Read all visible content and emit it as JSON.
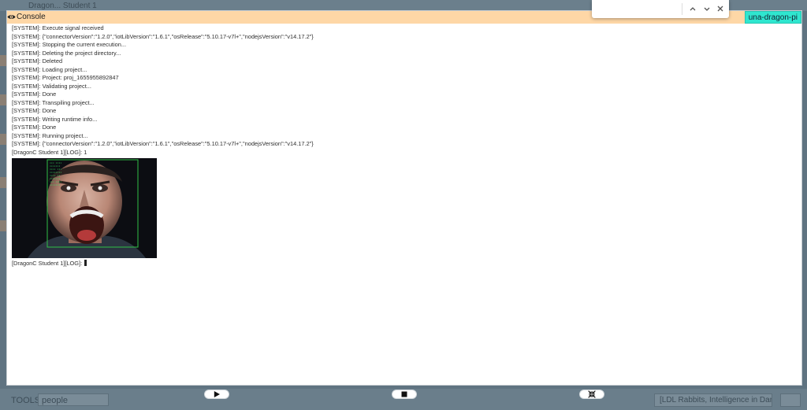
{
  "background": {
    "title": "Dragon... Student 1",
    "tools_label": "TOOLS",
    "search_value": "people",
    "select_value": "[LDL Rabbits, Intelligence in Dark",
    "accent_color": "#5f7381"
  },
  "console": {
    "title": "Console",
    "device": "una-dragon-pi",
    "header_color": "#fed7a6",
    "device_color": "#2fe6cf",
    "lines": [
      "[SYSTEM]: Execute signal received",
      "[SYSTEM]: {\"connectorVersion\":\"1.2.0\",\"iotLibVersion\":\"1.6.1\",\"osRelease\":\"5.10.17-v7l+\",\"nodejsVersion\":\"v14.17.2\"}",
      "[SYSTEM]: Stopping the current execution...",
      "[SYSTEM]: Deleting the project directory...",
      "[SYSTEM]: Deleted",
      "[SYSTEM]: Loading project...",
      "[SYSTEM]: Project: proj_1655955892847",
      "[SYSTEM]: Validating project...",
      "[SYSTEM]: Done",
      "[SYSTEM]: Transpiling project...",
      "[SYSTEM]: Done",
      "[SYSTEM]: Writing runtime info...",
      "[SYSTEM]: Done",
      "[SYSTEM]: Running project...",
      "[SYSTEM]: {\"connectorVersion\":\"1.2.0\",\"iotLibVersion\":\"1.6.1\",\"osRelease\":\"5.10.17-v7l+\",\"nodejsVersion\":\"v14.17.2\"}",
      "[DragonC Student 1][LOG]: 1"
    ],
    "final_line": "[DragonC Student 1][LOG]:"
  },
  "controls": {
    "play_icon": "play-icon",
    "stop_icon": "stop-icon",
    "collapse_icon": "collapse-icon"
  },
  "find_bar": {
    "value": "",
    "placeholder": ""
  }
}
